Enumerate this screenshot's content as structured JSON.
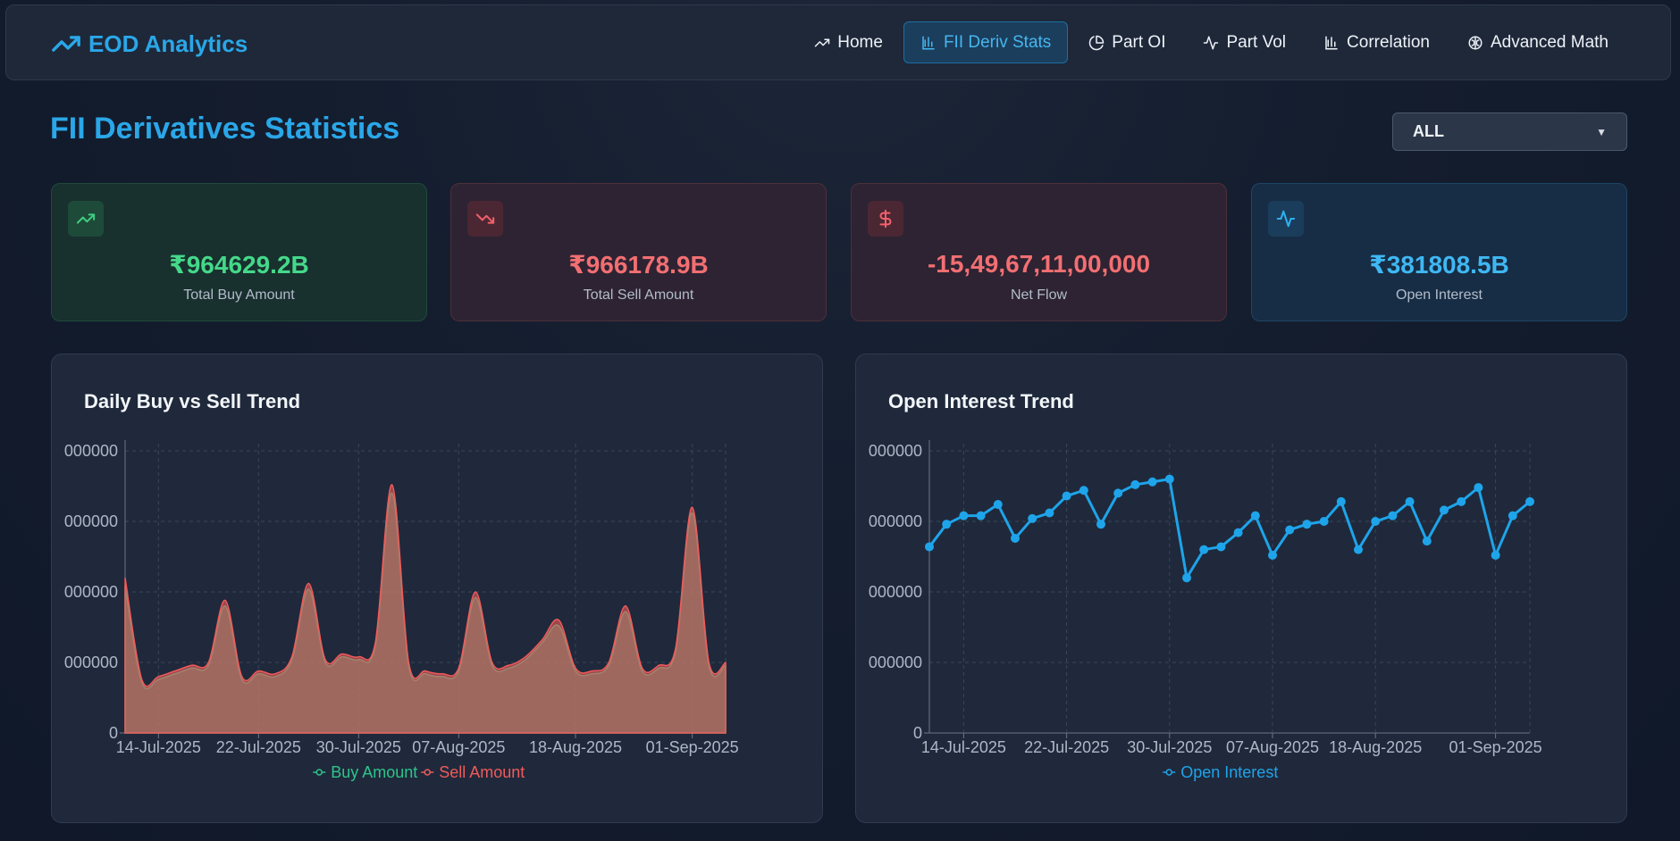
{
  "brand": {
    "name": "EOD Analytics",
    "icon": "trending-up-icon"
  },
  "nav": [
    {
      "label": "Home",
      "icon": "trending-up-icon",
      "active": false
    },
    {
      "label": "FII Deriv Stats",
      "icon": "bar-chart-icon",
      "active": true
    },
    {
      "label": "Part OI",
      "icon": "pie-chart-icon",
      "active": false
    },
    {
      "label": "Part Vol",
      "icon": "activity-icon",
      "active": false
    },
    {
      "label": "Correlation",
      "icon": "bar-chart-icon",
      "active": false
    },
    {
      "label": "Advanced Math",
      "icon": "brain-icon",
      "active": false
    }
  ],
  "page": {
    "title": "FII Derivatives Statistics"
  },
  "filter": {
    "selected": "ALL"
  },
  "stats": {
    "buy": {
      "value": "₹964629.2B",
      "label": "Total Buy Amount",
      "icon": "trending-up-icon",
      "color": "#45d88a"
    },
    "sell": {
      "value": "₹966178.9B",
      "label": "Total Sell Amount",
      "icon": "trending-down-icon",
      "color": "#f26f72"
    },
    "net": {
      "value": "-15,49,67,11,00,000",
      "label": "Net Flow",
      "icon": "dollar-icon",
      "color": "#f26f72"
    },
    "oi": {
      "value": "₹381808.5B",
      "label": "Open Interest",
      "icon": "activity-icon",
      "color": "#3fb8f3"
    }
  },
  "chart_data": [
    {
      "type": "area",
      "title": "Daily Buy vs Sell Trend",
      "x_ticks": [
        "14-Jul-2025",
        "22-Jul-2025",
        "30-Jul-2025",
        "07-Aug-2025",
        "18-Aug-2025",
        "01-Sep-2025"
      ],
      "y_ticks": [
        "0",
        "000000",
        "000000",
        "000000",
        "000000"
      ],
      "series": [
        {
          "name": "Buy Amount",
          "color": "#2ec48a",
          "values": [
            52,
            18,
            19,
            21,
            23,
            24,
            45,
            19,
            21,
            20,
            26,
            51,
            25,
            27,
            26,
            31,
            85,
            24,
            21,
            20,
            22,
            48,
            24,
            23,
            26,
            32,
            38,
            22,
            21,
            24,
            43,
            22,
            23,
            29,
            78,
            24,
            24
          ]
        },
        {
          "name": "Sell Amount",
          "color": "#f05a5a",
          "values": [
            55,
            19,
            20,
            22,
            24,
            25,
            47,
            20,
            22,
            21,
            27,
            53,
            26,
            28,
            27,
            32,
            88,
            25,
            22,
            21,
            23,
            50,
            25,
            24,
            27,
            33,
            40,
            23,
            22,
            25,
            45,
            23,
            24,
            30,
            80,
            25,
            25
          ]
        }
      ]
    },
    {
      "type": "line",
      "title": "Open Interest Trend",
      "x_ticks": [
        "14-Jul-2025",
        "22-Jul-2025",
        "30-Jul-2025",
        "07-Aug-2025",
        "18-Aug-2025",
        "01-Sep-2025"
      ],
      "y_ticks": [
        "0",
        "000000",
        "000000",
        "000000",
        "000000"
      ],
      "series": [
        {
          "name": "Open Interest",
          "color": "#1ea4ea",
          "values": [
            66,
            74,
            77,
            77,
            81,
            69,
            76,
            78,
            84,
            86,
            74,
            85,
            88,
            89,
            90,
            55,
            65,
            66,
            71,
            77,
            63,
            72,
            74,
            75,
            82,
            65,
            75,
            77,
            82,
            68,
            79,
            82,
            87,
            63,
            77,
            82
          ]
        }
      ]
    }
  ]
}
